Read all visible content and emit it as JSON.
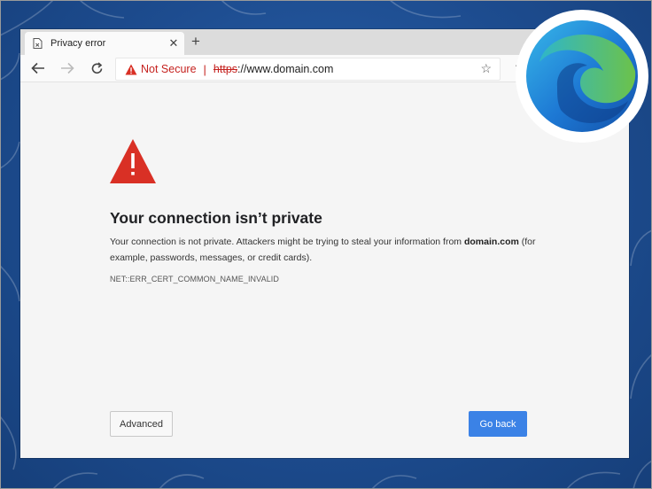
{
  "browser": {
    "tab": {
      "title": "Privacy error"
    },
    "newtab_symbol": "+",
    "close_symbol": "✕",
    "address": {
      "security_label": "Not Secure",
      "separator": "|",
      "scheme": "https",
      "rest": "://www.domain.com"
    },
    "star_symbol": "☆",
    "menu_symbol": "⌄"
  },
  "page": {
    "heading": "Your connection isn’t private",
    "desc_prefix": "Your connection is not private. Attackers might be trying to steal your information from ",
    "desc_domain": "domain.com",
    "desc_suffix": " (for example, passwords, messages, or credit cards).",
    "error_code": "NET::ERR_CERT_COMMON_NAME_INVALID",
    "advanced_label": "Advanced",
    "back_label": "Go back"
  },
  "colors": {
    "accent_button": "#3b82e6",
    "warning_red": "#d93025",
    "not_secure_text": "#c5221f"
  },
  "icons": [
    "page-error-icon",
    "back-arrow-icon",
    "forward-arrow-icon",
    "refresh-icon",
    "warning-triangle-icon",
    "star-icon",
    "edge-logo-icon"
  ]
}
